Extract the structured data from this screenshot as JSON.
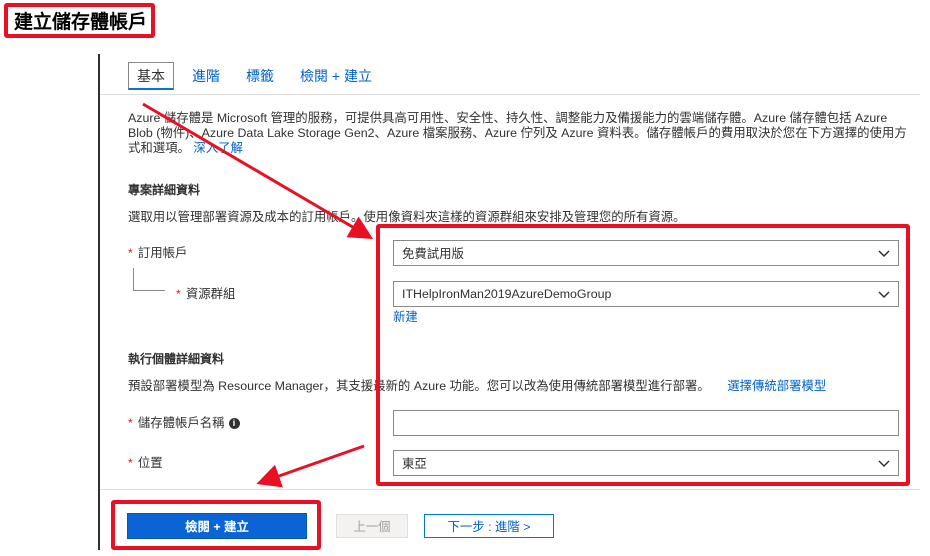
{
  "page_title": "建立儲存體帳戶",
  "tabs": [
    {
      "label": "基本"
    },
    {
      "label": "進階"
    },
    {
      "label": "標籤"
    },
    {
      "label": "檢閱 + 建立"
    }
  ],
  "description": {
    "text": "Azure 儲存體是 Microsoft 管理的服務，可提供具高可用性、安全性、持久性、調整能力及備援能力的雲端儲存體。Azure 儲存體包括 Azure Blob (物件)、Azure Data Lake Storage Gen2、Azure 檔案服務、Azure 佇列及 Azure 資料表。儲存體帳戶的費用取決於您在下方選擇的使用方式和選項。",
    "link": "深入了解"
  },
  "project_details": {
    "heading": "專案詳細資料",
    "text": "選取用以管理部署資源及成本的訂用帳戶。使用像資料夾這樣的資源群組來安排及管理您的所有資源。",
    "subscription_label": "訂用帳戶",
    "subscription_value": "免費試用版",
    "resource_group_label": "資源群組",
    "resource_group_value": "ITHelpIronMan2019AzureDemoGroup",
    "new_link": "新建"
  },
  "instance_details": {
    "heading": "執行個體詳細資料",
    "text": "預設部署模型為 Resource Manager，其支援最新的 Azure 功能。您可以改為使用傳統部署模型進行部署。",
    "classic_link": "選擇傳統部署模型",
    "name_label": "儲存體帳戶名稱",
    "name_value": "",
    "info_icon": "i",
    "location_label": "位置",
    "location_value": "東亞"
  },
  "footer": {
    "review_create": "檢閱 + 建立",
    "previous": "上一個",
    "next": "下一步 : 進階 >"
  },
  "required_mark": "*",
  "colors": {
    "accent": "#0078d4",
    "primary_button": "#0a64d6",
    "highlight": "#e81123",
    "link": "#0060c7"
  }
}
